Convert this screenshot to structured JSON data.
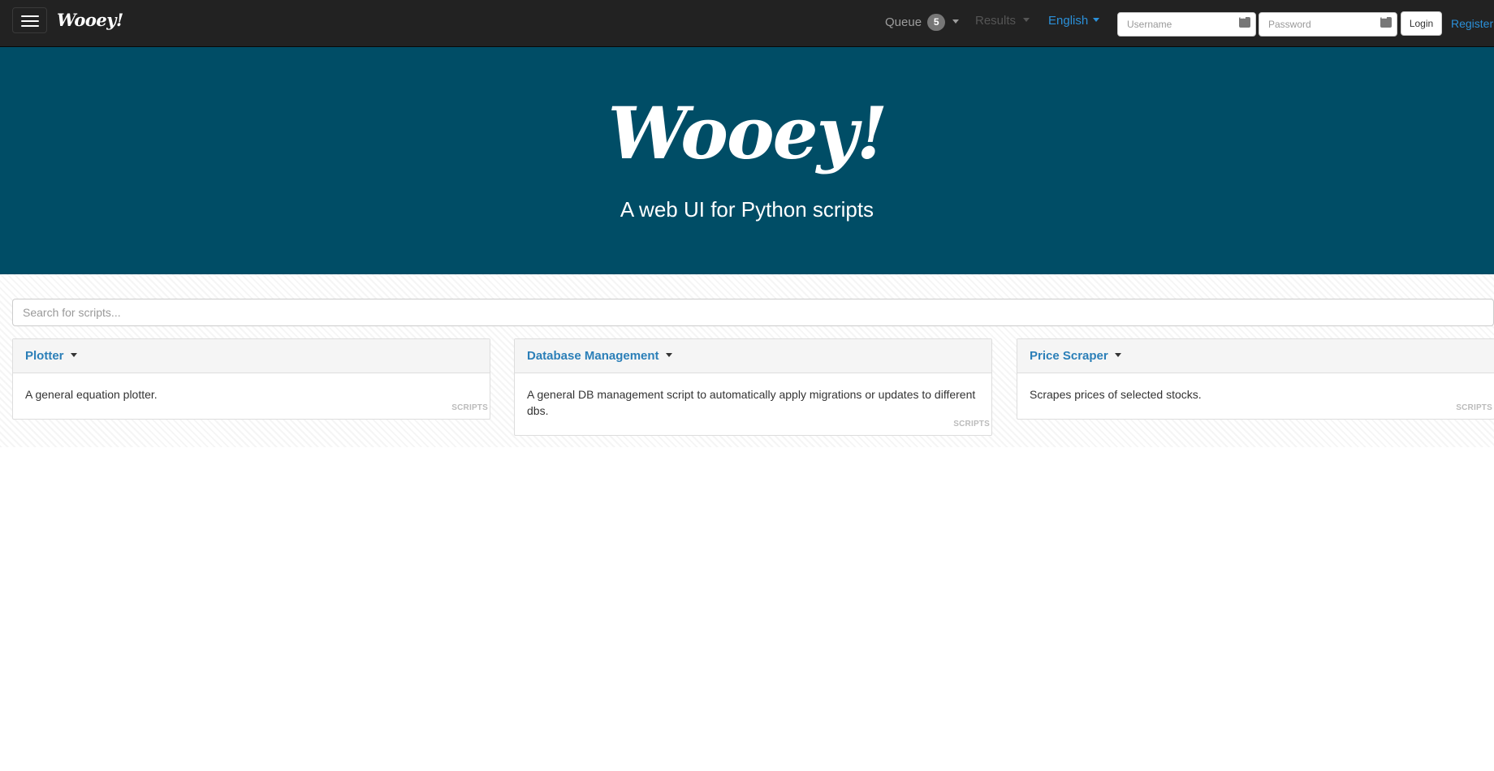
{
  "navbar": {
    "brand": "Wooey!",
    "queue_label": "Queue",
    "queue_count": "5",
    "results_label": "Results",
    "language_label": "English",
    "username_placeholder": "Username",
    "password_placeholder": "Password",
    "login_label": "Login",
    "register_label": "Register"
  },
  "hero": {
    "title": "Wooey!",
    "subtitle": "A web UI for Python scripts"
  },
  "search": {
    "placeholder": "Search for scripts..."
  },
  "scripts": [
    {
      "name": "Plotter",
      "description": "A general equation plotter.",
      "tag": "SCRIPTS"
    },
    {
      "name": "Database Management",
      "description": "A general DB management script to automatically apply migrations or updates to different dbs.",
      "tag": "SCRIPTS"
    },
    {
      "name": "Price Scraper",
      "description": "Scrapes prices of selected stocks.",
      "tag": "SCRIPTS"
    }
  ],
  "colors": {
    "navbar_bg": "#222222",
    "hero_bg": "#004d66",
    "link": "#2b90d9",
    "card_title": "#2b7fb8"
  }
}
